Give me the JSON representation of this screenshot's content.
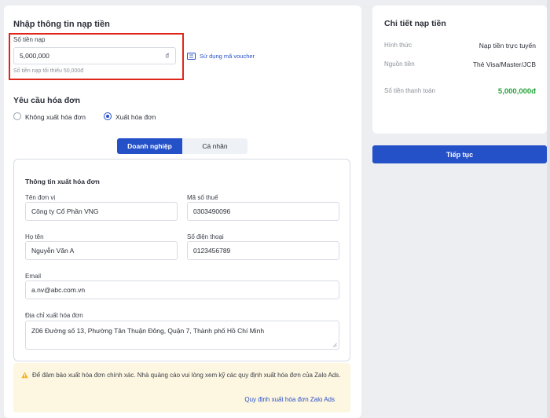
{
  "topup": {
    "section_title": "Nhập thông tin nạp tiền",
    "amount_label": "Số tiền nạp",
    "amount_value": "5,000,000",
    "amount_unit": "đ",
    "amount_hint": "Số tiền nạp tối thiểu 50,000đ",
    "voucher_link": "Sử dụng mã voucher"
  },
  "invoice_request": {
    "title": "Yêu cầu hóa đơn",
    "options": [
      {
        "label": "Không xuất hóa đơn",
        "selected": false
      },
      {
        "label": "Xuất hóa đơn",
        "selected": true
      }
    ],
    "tabs": [
      {
        "label": "Doanh nghiệp",
        "active": true
      },
      {
        "label": "Cá nhân",
        "active": false
      }
    ]
  },
  "invoice_info": {
    "title": "Thông tin xuất hóa đơn",
    "company_label": "Tên đơn vị",
    "company_value": "Công ty Cổ Phần VNG",
    "tax_label": "Mã số thuế",
    "tax_value": "0303490096",
    "name_label": "Họ tên",
    "name_value": "Nguyễn Văn A",
    "phone_label": "Số điện thoại",
    "phone_value": "0123456789",
    "email_label": "Email",
    "email_value": "a.nv@abc.com.vn",
    "address_label": "Địa chỉ xuất hóa đơn",
    "address_value": "Z06 Đường số 13, Phường Tân Thuận Đông, Quận 7, Thành phố Hồ Chí Minh"
  },
  "notice": {
    "text": "Để đảm bảo xuất hóa đơn chính xác. Nhà quảng cáo vui lòng xem kỹ các quy định xuất hóa đơn của Zalo Ads.",
    "link": "Quy định xuất hóa đơn Zalo Ads",
    "icon": "warning-icon"
  },
  "summary": {
    "title": "Chi tiết nạp tiền",
    "method_label": "Hình thức",
    "method_value": "Nạp tiền trực tuyến",
    "source_label": "Nguồn tiền",
    "source_value": "Thẻ Visa/Master/JCB",
    "total_label": "Số tiền thanh toán",
    "total_value": "5,000,000đ"
  },
  "actions": {
    "continue_label": "Tiếp tục"
  },
  "colors": {
    "primary": "#2450c8",
    "highlight": "#e0261c",
    "amount_green": "#27a33a",
    "notice_bg": "#fdf6e0"
  }
}
